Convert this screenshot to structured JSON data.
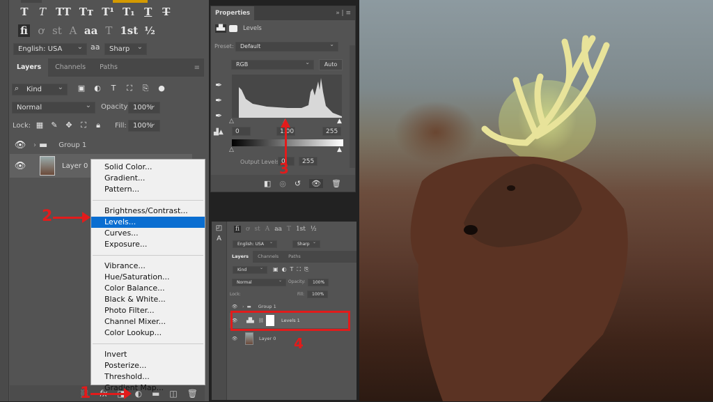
{
  "left_panel": {
    "character_styles": [
      "T",
      "T",
      "TT",
      "Tт",
      "T¹",
      "T₁",
      "T",
      "T"
    ],
    "opentype_features": [
      "fi",
      "ơ",
      "st",
      "A",
      "aa",
      "T",
      "1st",
      "½"
    ],
    "language": "English: USA",
    "aa_icon": "aa",
    "antialias": "Sharp",
    "tabs": [
      "Layers",
      "Channels",
      "Paths"
    ],
    "filter_kind": "Kind",
    "blend_mode": "Normal",
    "opacity_label": "Opacity:",
    "opacity": "100%",
    "lock_label": "Lock:",
    "fill_label": "Fill:",
    "fill": "100%",
    "layers": [
      {
        "name": "Group 1",
        "type": "group"
      },
      {
        "name": "Layer 0",
        "type": "pixel"
      }
    ]
  },
  "adjustment_menu": {
    "groups": [
      [
        "Solid Color...",
        "Gradient...",
        "Pattern..."
      ],
      [
        "Brightness/Contrast...",
        "Levels...",
        "Curves...",
        "Exposure..."
      ],
      [
        "Vibrance...",
        "Hue/Saturation...",
        "Color Balance...",
        "Black & White...",
        "Photo Filter...",
        "Channel Mixer...",
        "Color Lookup..."
      ],
      [
        "Invert",
        "Posterize...",
        "Threshold...",
        "Gradient Map..."
      ]
    ],
    "highlighted": "Levels..."
  },
  "annotations": {
    "step1": "1",
    "step2": "2",
    "step3": "3",
    "step4": "4",
    "color": "#e21b1b"
  },
  "properties": {
    "title": "Properties",
    "adjustment": "Levels",
    "preset_label": "Preset:",
    "preset": "Default",
    "channel": "RGB",
    "auto_label": "Auto",
    "input_black": "0",
    "input_gamma": "1.00",
    "input_white": "255",
    "output_label": "Output Levels:",
    "output_black": "0",
    "output_white": "255"
  },
  "mini_layers": {
    "language": "English: USA",
    "antialias": "Sharp",
    "tabs": [
      "Layers",
      "Channels",
      "Paths"
    ],
    "filter_kind": "Kind",
    "blend_mode": "Normal",
    "opacity_label": "Opacity:",
    "opacity": "100%",
    "lock_label": "Lock:",
    "fill_label": "Fill:",
    "fill": "100%",
    "layers": [
      {
        "name": "Group 1"
      },
      {
        "name": "Levels 1"
      },
      {
        "name": "Layer 0"
      }
    ]
  },
  "accent_colors": {
    "menu_highlight": "#0a6ed1",
    "panel_bg": "#535353"
  }
}
